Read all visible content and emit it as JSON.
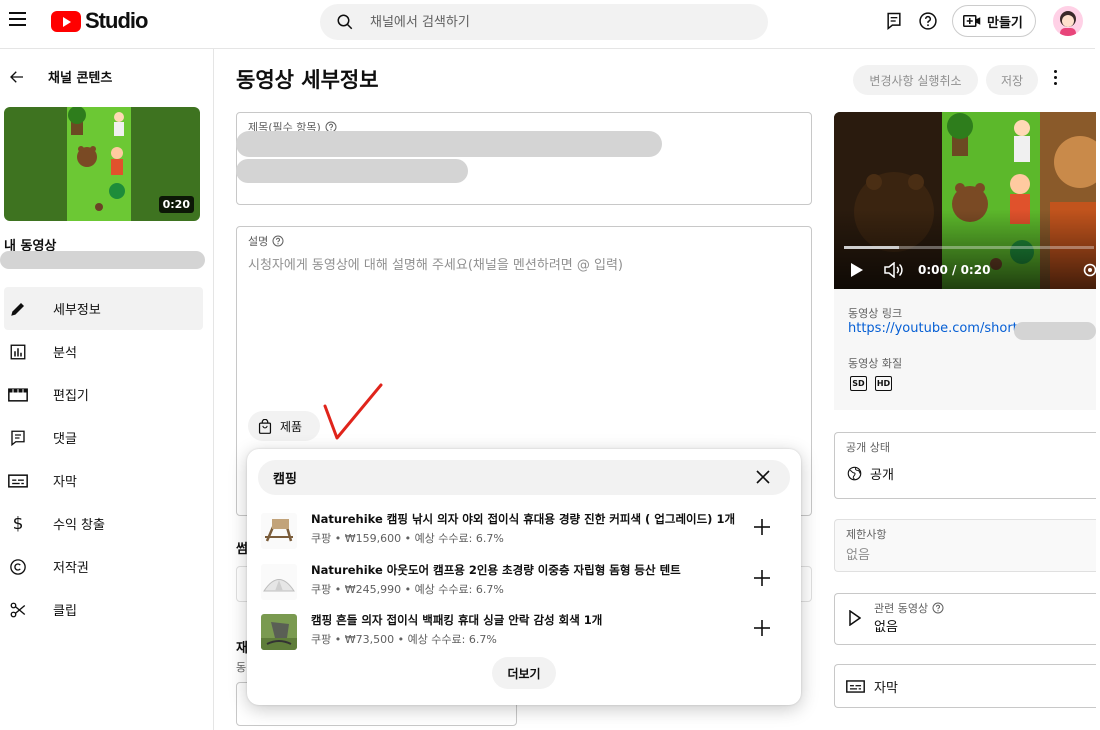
{
  "header": {
    "logo_text": "Studio",
    "search_placeholder": "채널에서 검색하기",
    "create_label": "만들기"
  },
  "sidebar": {
    "back_label": "채널 콘텐츠",
    "thumbnail_duration": "0:20",
    "my_video_label": "내 동영상",
    "items": [
      {
        "label": "세부정보",
        "icon": "pencil-icon",
        "active": true
      },
      {
        "label": "분석",
        "icon": "analytics-icon",
        "active": false
      },
      {
        "label": "편집기",
        "icon": "editor-icon",
        "active": false
      },
      {
        "label": "댓글",
        "icon": "comments-icon",
        "active": false
      },
      {
        "label": "자막",
        "icon": "subtitles-icon",
        "active": false
      },
      {
        "label": "수익 창출",
        "icon": "dollar-icon",
        "active": false
      },
      {
        "label": "저작권",
        "icon": "copyright-icon",
        "active": false
      },
      {
        "label": "클립",
        "icon": "scissors-icon",
        "active": false
      }
    ]
  },
  "main": {
    "page_title": "동영상 세부정보",
    "undo_label": "변경사항 실행취소",
    "save_label": "저장",
    "title_field_label": "제목(필수 항목)",
    "description_label": "설명",
    "description_placeholder": "시청자에게 동영상에 대해 설명해 주세요(채널을 멘션하려면 @ 입력)",
    "product_chip_label": "제품",
    "partial_thumbnail_heading": "썸",
    "partial_playlist_heading": "재",
    "partial_playlist_sub": "동"
  },
  "product_popup": {
    "search_value": "캠핑",
    "products": [
      {
        "title": "Naturehike 캠핑 낚시 의자 야외 접이식 휴대용 경량 진한 커피색 ( 업그레이드) 1개",
        "meta": "쿠팡 • ₩159,600 • 예상 수수료: 6.7%"
      },
      {
        "title": "Naturehike 아웃도어 캠프용 2인용 초경량 이중층 자립형 돔형 등산 텐트",
        "meta": "쿠팡 • ₩245,990 • 예상 수수료: 6.7%"
      },
      {
        "title": "캠핑 흔들 의자 접이식 백패킹 휴대 싱글 안락 감성 회색 1개",
        "meta": "쿠팡 • ₩73,500 • 예상 수수료: 6.7%"
      }
    ],
    "more_label": "더보기"
  },
  "right_panel": {
    "player_time": "0:00 / 0:20",
    "player_progress": 0.22,
    "video_link_label": "동영상 링크",
    "video_link": "https://youtube.com/shorts",
    "video_quality_label": "동영상 화질",
    "quality_badges": [
      "SD",
      "HD"
    ],
    "visibility_label": "공개 상태",
    "visibility_value": "공개",
    "restrictions_label": "제한사항",
    "restrictions_value": "없음",
    "related_label": "관련 동영상",
    "related_value": "없음",
    "subtitles_value": "자막"
  },
  "colors": {
    "brand_red": "#ff0000",
    "link_blue": "#065fd4",
    "annotation_red": "#e0241b"
  }
}
